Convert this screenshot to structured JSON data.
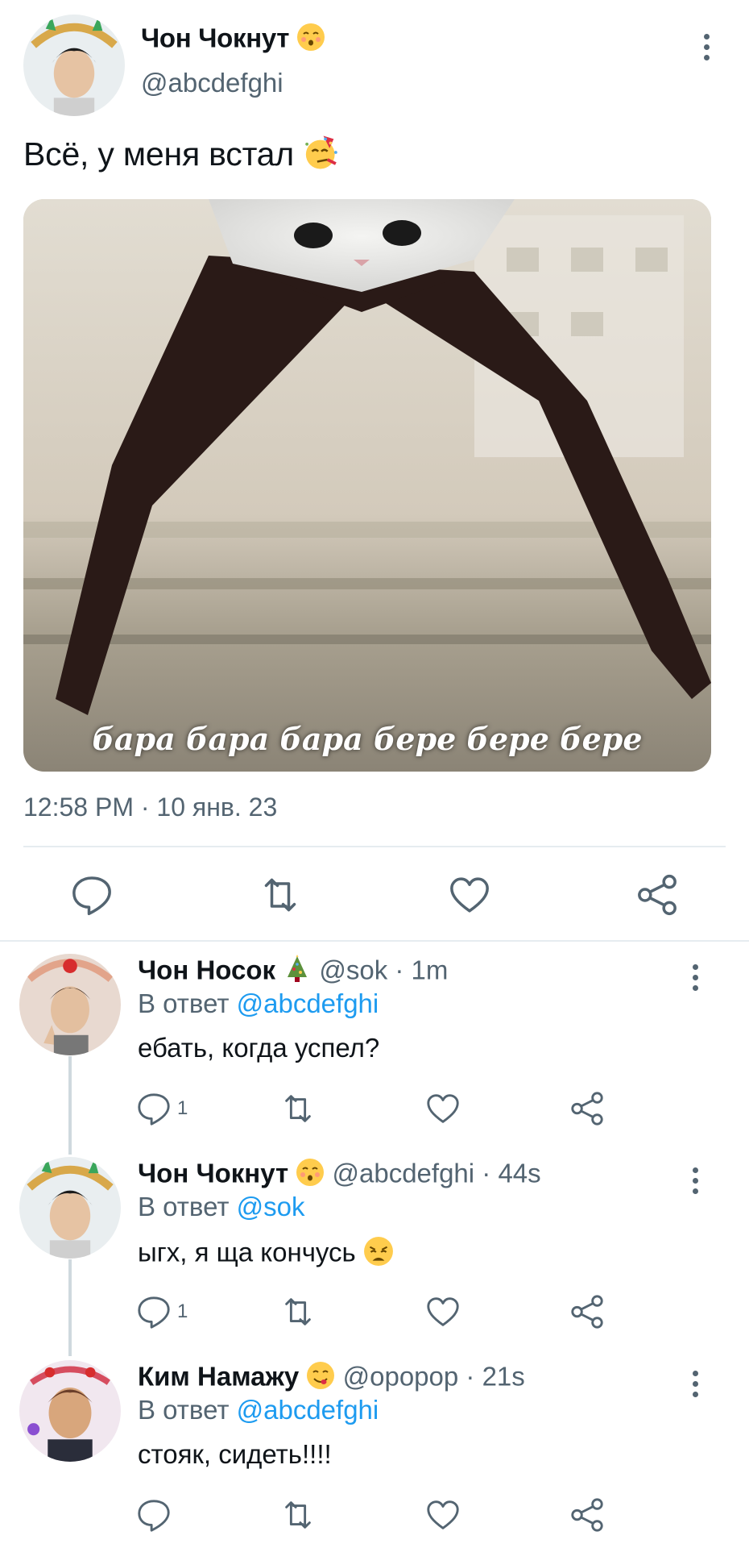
{
  "main": {
    "author_name": "Чон Чокнут",
    "author_emoji": "kissing-face-emoji",
    "handle": "@abcdefghi",
    "text": "Всё, у меня встал",
    "text_emoji": "partying-face-emoji",
    "media_caption": "бара бара бара бере бере бере",
    "timestamp": "12:58 PM · 10 янв. 23"
  },
  "replies": [
    {
      "name": "Чон Носок",
      "emoji": "christmas-tree-emoji",
      "meta": "@sok · 1m",
      "reply_prefix": "В ответ ",
      "reply_to": "@abcdefghi",
      "text": "ебать,  когда успел?",
      "reply_count": "1"
    },
    {
      "name": "Чон Чокнут",
      "emoji": "kissing-face-emoji",
      "meta": "@abcdefghi · 44s",
      "reply_prefix": "В ответ ",
      "reply_to": "@sok",
      "text": "ыгх, я ща кончусь",
      "text_emoji": "weary-face-emoji",
      "reply_count": "1"
    },
    {
      "name": "Ким Намажу",
      "emoji": "yum-face-emoji",
      "meta": "@opopop · 21s",
      "reply_prefix": "В ответ ",
      "reply_to": "@abcdefghi",
      "text": "стояк, сидеть!!!!",
      "reply_count": ""
    }
  ],
  "colors": {
    "link": "#1d9bf0",
    "secondary_text": "#536471",
    "primary_text": "#0f1419",
    "divider": "#e6ecf0"
  },
  "icons": [
    "comment-icon",
    "retweet-icon",
    "like-icon",
    "share-icon",
    "more-icon"
  ]
}
